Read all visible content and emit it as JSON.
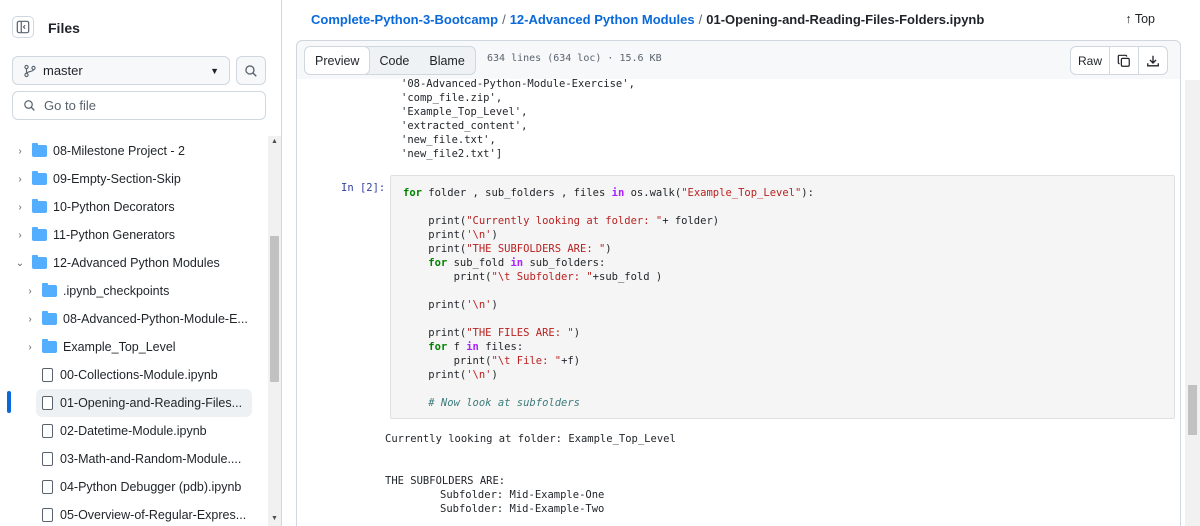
{
  "sidebar": {
    "title": "Files",
    "branch": "master",
    "goto_placeholder": "Go to file",
    "items": [
      {
        "label": "08-Milestone Project - 2",
        "kind": "folder",
        "chevron": "›"
      },
      {
        "label": "09-Empty-Section-Skip",
        "kind": "folder",
        "chevron": "›"
      },
      {
        "label": "10-Python Decorators",
        "kind": "folder",
        "chevron": "›"
      },
      {
        "label": "11-Python Generators",
        "kind": "folder",
        "chevron": "›"
      },
      {
        "label": "12-Advanced Python Modules",
        "kind": "folder",
        "chevron": "⌄"
      },
      {
        "label": ".ipynb_checkpoints",
        "kind": "folder",
        "chevron": "›"
      },
      {
        "label": "08-Advanced-Python-Module-E...",
        "kind": "folder",
        "chevron": "›"
      },
      {
        "label": "Example_Top_Level",
        "kind": "folder",
        "chevron": "›"
      },
      {
        "label": "00-Collections-Module.ipynb",
        "kind": "file",
        "chevron": ""
      },
      {
        "label": "01-Opening-and-Reading-Files...",
        "kind": "file",
        "chevron": "",
        "active": true
      },
      {
        "label": "02-Datetime-Module.ipynb",
        "kind": "file",
        "chevron": ""
      },
      {
        "label": "03-Math-and-Random-Module....",
        "kind": "file",
        "chevron": ""
      },
      {
        "label": "04-Python Debugger (pdb).ipynb",
        "kind": "file",
        "chevron": ""
      },
      {
        "label": "05-Overview-of-Regular-Expres...",
        "kind": "file",
        "chevron": ""
      }
    ]
  },
  "breadcrumb": {
    "repo": "Complete-Python-3-Bootcamp",
    "folder": "12-Advanced Python Modules",
    "file": "01-Opening-and-Reading-Files-Folders.ipynb",
    "sep": "/"
  },
  "top_link": "Top",
  "file_bar": {
    "tabs": [
      "Preview",
      "Code",
      "Blame"
    ],
    "meta": "634 lines (634 loc) · 15.6 KB",
    "raw_label": "Raw"
  },
  "notebook": {
    "prev_output": [
      "'08-Advanced-Python-Module-Exercise',",
      "'comp_file.zip',",
      "'Example_Top_Level',",
      "'extracted_content',",
      "'new_file.txt',",
      "'new_file2.txt']"
    ],
    "in_prompt": "In [2]:",
    "code_line1": {
      "kw1": "for",
      "t1": " folder , sub_folders , files ",
      "kw2": "in",
      "t2": " os.walk(",
      "s1": "\"Example_Top_Level\"",
      "t3": "):"
    },
    "code_print1": {
      "pre": "    print(",
      "str": "\"Currently looking at folder: \"",
      "post": "+ folder)"
    },
    "code_print2": {
      "pre": "    print(",
      "str": "'\\n'",
      "post": ")"
    },
    "code_print3": {
      "pre": "    print(",
      "str": "\"THE SUBFOLDERS ARE: \"",
      "post": ")"
    },
    "code_for2": {
      "kw": "    for",
      "t1": " sub_fold ",
      "kw2": "in",
      "t2": " sub_folders:"
    },
    "code_print4": {
      "pre": "        print(",
      "str": "\"\\t Subfolder: \"",
      "post": "+sub_fold )"
    },
    "code_print5": {
      "pre": "    print(",
      "str": "'\\n'",
      "post": ")"
    },
    "code_print6": {
      "pre": "    print(",
      "str": "\"THE FILES ARE: \"",
      "post": ")"
    },
    "code_for3": {
      "kw": "    for",
      "t1": " f ",
      "kw2": "in",
      "t2": " files:"
    },
    "code_print7": {
      "pre": "        print(",
      "str": "\"\\t File: \"",
      "post": "+f)"
    },
    "code_print8": {
      "pre": "    print(",
      "str": "'\\n'",
      "post": ")"
    },
    "comment": "    # Now look at subfolders",
    "output_lines": [
      "Currently looking at folder: Example_Top_Level",
      "",
      "",
      "THE SUBFOLDERS ARE: ",
      "\t Subfolder: Mid-Example-One",
      "\t Subfolder: Mid-Example-Two"
    ]
  }
}
